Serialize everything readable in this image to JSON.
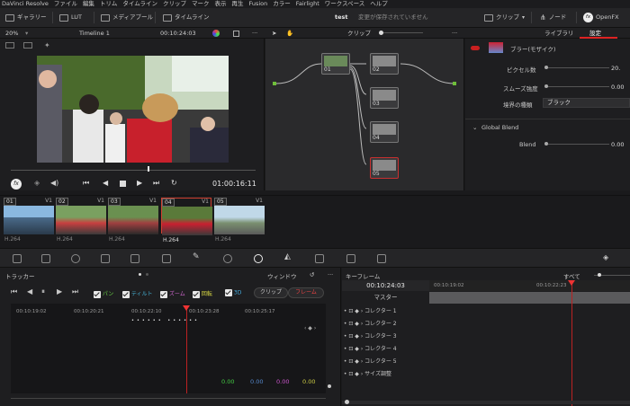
{
  "menu": [
    "DaVinci Resolve",
    "ファイル",
    "編集",
    "トリム",
    "タイムライン",
    "クリップ",
    "マーク",
    "表示",
    "再生",
    "Fusion",
    "カラー",
    "Fairlight",
    "ワークスペース",
    "ヘルプ"
  ],
  "toolbar": {
    "gallery": "ギャラリー",
    "lut": "LUT",
    "media_pool": "メディアプール",
    "timeline": "タイムライン",
    "project_title": "test",
    "unsaved": "変更が保存されていません",
    "clip": "クリップ",
    "node": "ノード",
    "openfx": "OpenFX"
  },
  "viewer": {
    "zoom": "20%",
    "timeline_name": "Timeline 1",
    "timecode": "00:10:24:03",
    "playback_timecode": "01:00:16:11",
    "node_mode": "クリップ"
  },
  "inspector": {
    "tab_library": "ライブラリ",
    "tab_settings": "設定",
    "effect_name": "ブラー(モザイク)",
    "pixel_label": "ピクセル数",
    "pixel_value": "20.",
    "smooth_label": "スムーズ強度",
    "smooth_value": "0.00",
    "border_label": "境界の種類",
    "border_value": "ブラック",
    "global_blend": "Global Blend",
    "blend_label": "Blend",
    "blend_value": "0.00"
  },
  "nodes": [
    "01",
    "02",
    "03",
    "04",
    "05"
  ],
  "clips": [
    {
      "num": "01",
      "track": "V1",
      "format": "H.264",
      "color": "#6fa0c8"
    },
    {
      "num": "02",
      "track": "V1",
      "format": "H.264",
      "color": "#8ab070"
    },
    {
      "num": "03",
      "track": "V1",
      "format": "H.264",
      "color": "#7a9a60"
    },
    {
      "num": "04",
      "track": "V1",
      "format": "H.264",
      "color": "#c87060"
    },
    {
      "num": "05",
      "track": "V1",
      "format": "H.264",
      "color": "#90b0c8"
    }
  ],
  "tracker": {
    "title": "トラッカー",
    "window": "ウィンドウ",
    "pan": "パン",
    "tilt": "ティルト",
    "zoom": "ズーム",
    "rotate": "回転",
    "three_d": "3D",
    "clip_btn": "クリップ",
    "frame_btn": "フレーム",
    "ruler": [
      "00:10:19:02",
      "00:10:20:21",
      "00:10:22:10",
      "00:10:23:28",
      "00:10:25:17"
    ],
    "values": [
      "0.00",
      "0.00",
      "0.00",
      "0.00"
    ]
  },
  "keyframes": {
    "title": "キーフレーム",
    "all": "すべて",
    "timecode": "00:10:24:03",
    "ruler": [
      "00:10:19:02",
      "00:10:22:23"
    ],
    "master": "マスター",
    "rows": [
      "コレクター 1",
      "コレクター 2",
      "コレクター 3",
      "コレクター 4",
      "コレクター 5",
      "サイズ調整"
    ]
  }
}
